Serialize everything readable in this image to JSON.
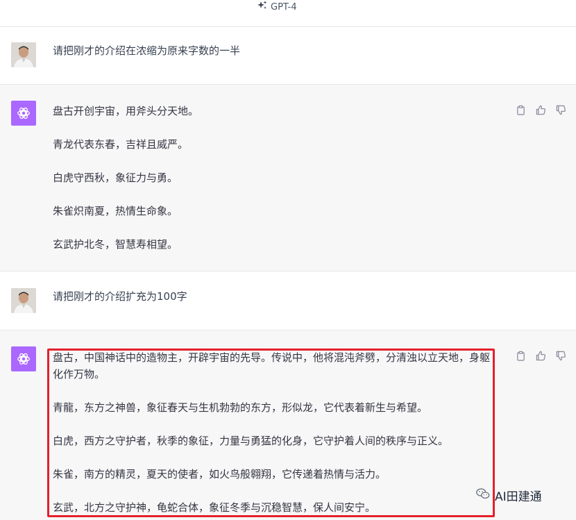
{
  "header": {
    "model_name": "GPT-4",
    "model_icon": "sparkle-icon"
  },
  "conversation": [
    {
      "role": "user",
      "text": "请把刚才的介绍在浓缩为原来字数的一半"
    },
    {
      "role": "assistant",
      "paragraphs": [
        "盘古开创宇宙，用斧头分天地。",
        "青龙代表东春，吉祥且威严。",
        "白虎守西秋，象征力与勇。",
        "朱雀炽南夏，热情生命象。",
        "玄武护北冬，智慧寿相望。"
      ]
    },
    {
      "role": "user",
      "text": "请把刚才的介绍扩充为100字"
    },
    {
      "role": "assistant",
      "paragraphs": [
        "盘古，中国神话中的造物主，开辟宇宙的先导。传说中，他将混沌斧劈，分清浊以立天地，身躯化作万物。",
        "青龍，东方之神兽，象征春天与生机勃勃的东方，形似龙，它代表着新生与希望。",
        "白虎，西方之守护者，秋季的象征，力量与勇猛的化身，它守护着人间的秩序与正义。",
        "朱雀，南方的精灵，夏天的使者，如火鸟般翱翔，它传递着热情与活力。",
        "玄武，北方之守护神，龟蛇合体，象征冬季与沉稳智慧，保人间安宁。"
      ]
    }
  ],
  "actions": [
    "clipboard-icon",
    "thumbs-up-icon",
    "thumbs-down-icon"
  ],
  "watermark": {
    "text": "AI田建通",
    "icon": "wechat-icon"
  },
  "colors": {
    "assistant_bg": "#f7f7f8",
    "gpt_avatar": "#ab68ff",
    "highlight_border": "#e5202b"
  }
}
